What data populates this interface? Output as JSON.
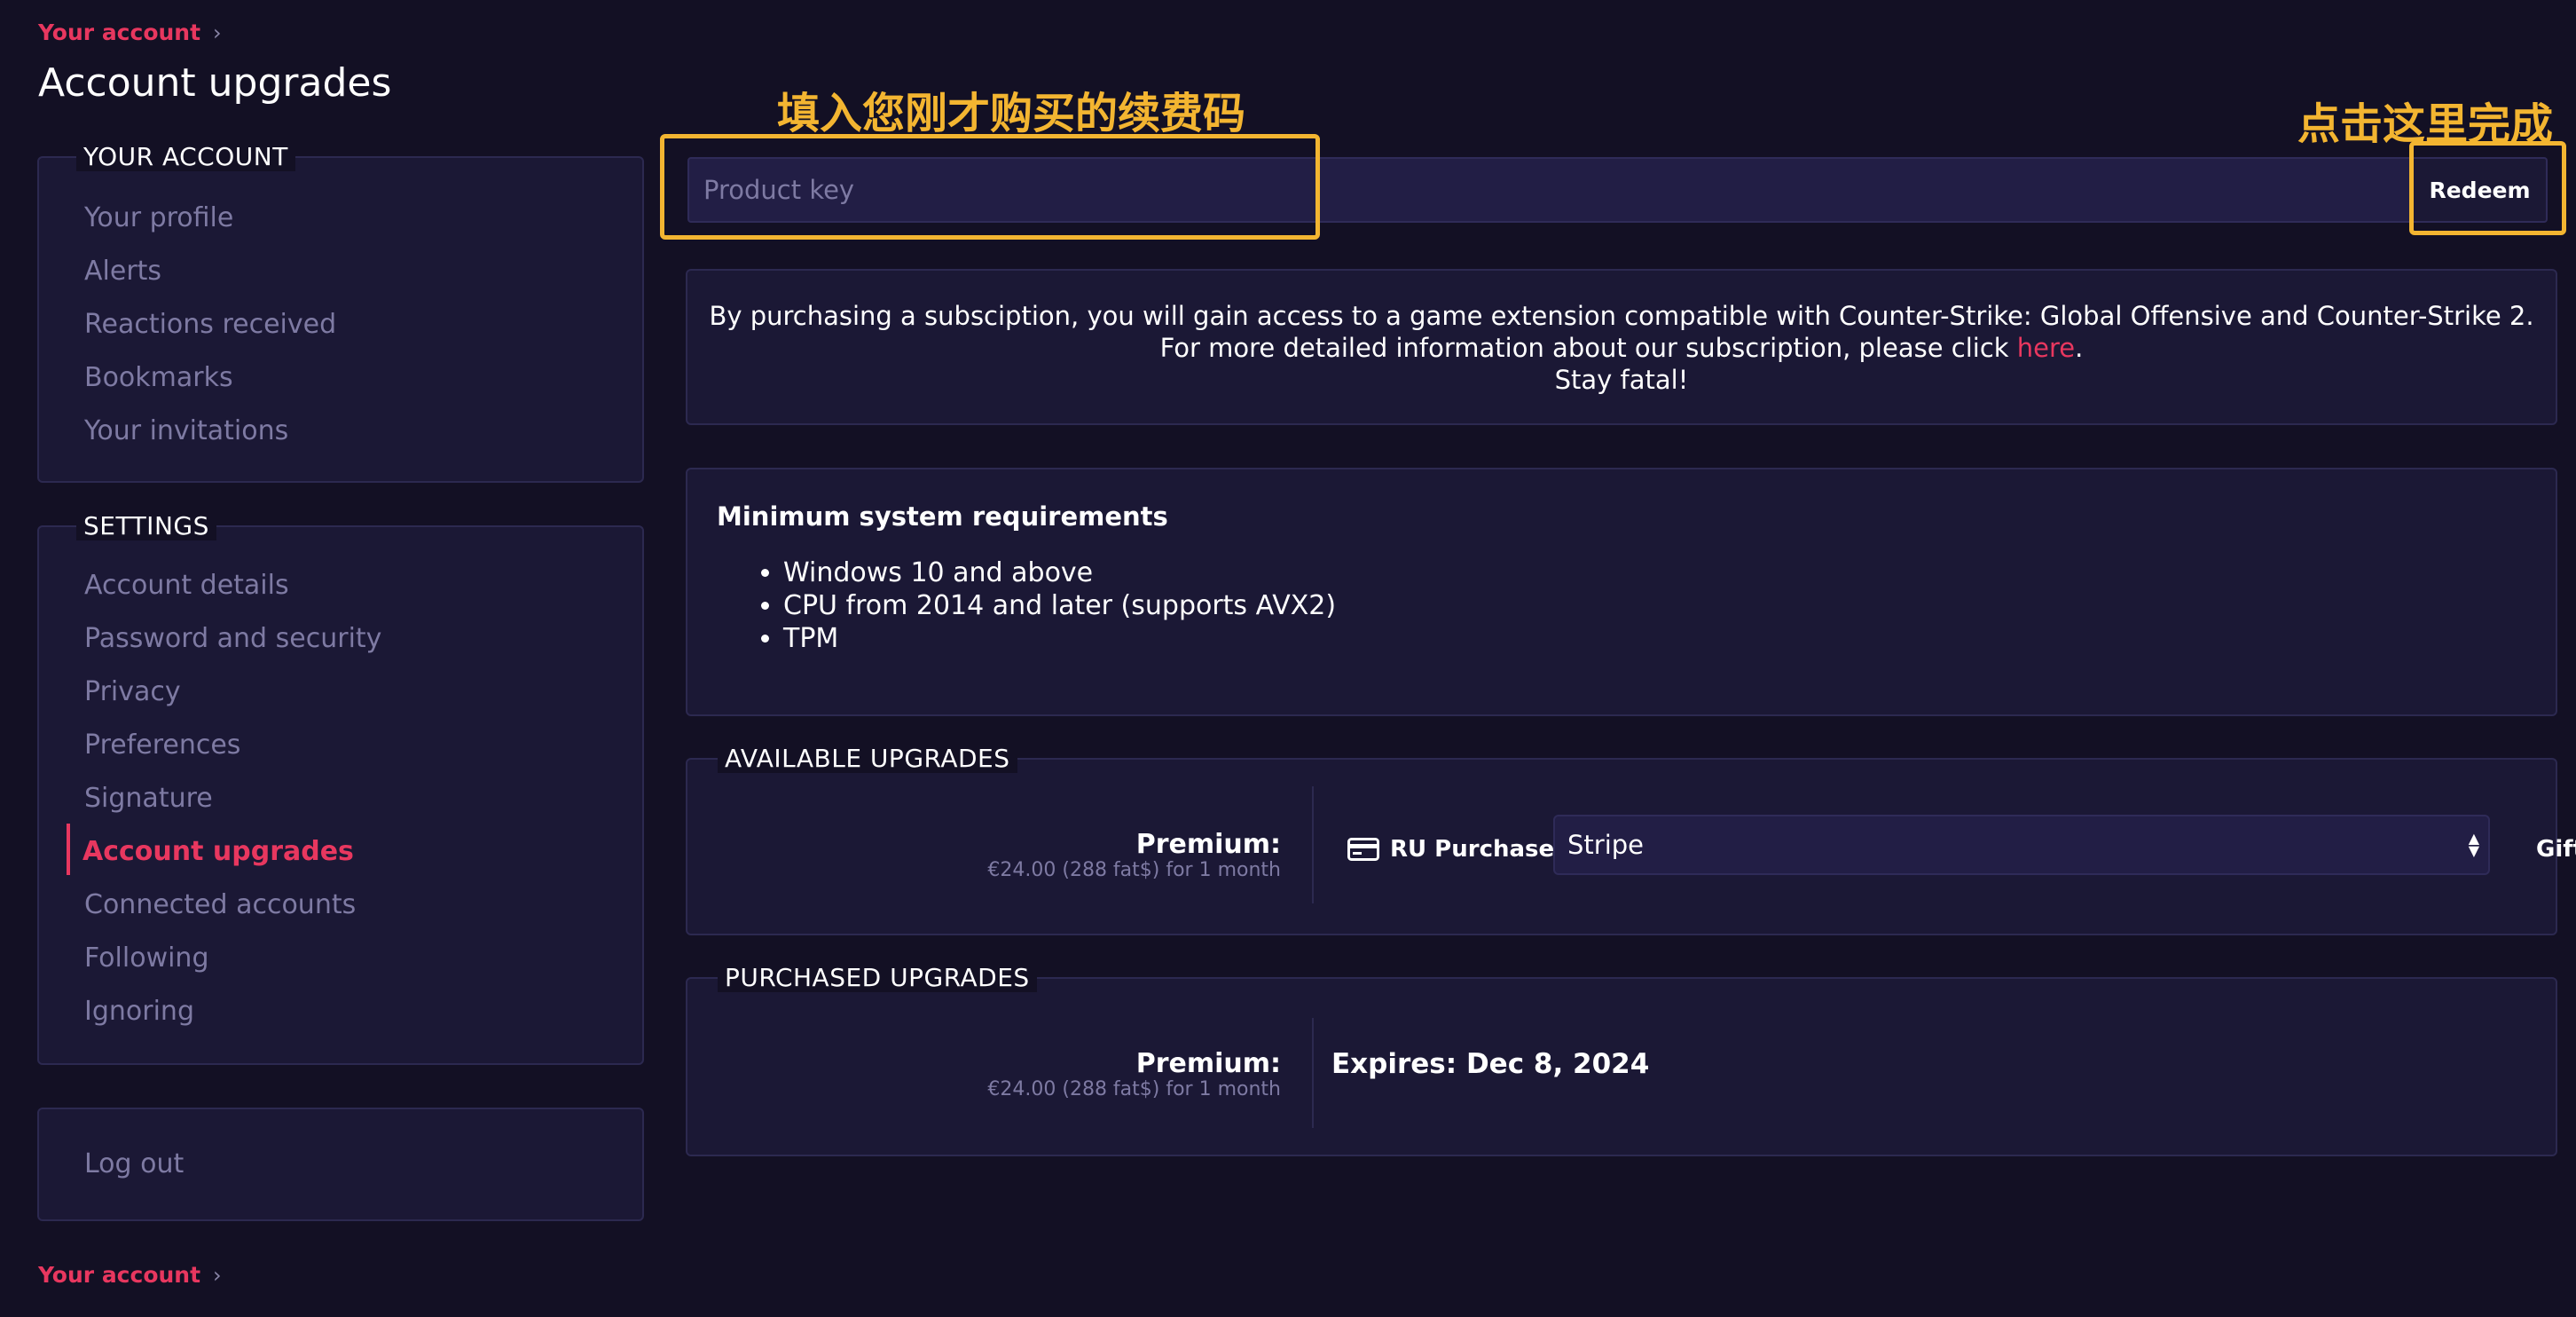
{
  "breadcrumb": {
    "label": "Your account"
  },
  "page_title": "Account upgrades",
  "sidebar": {
    "account_section": {
      "title": "YOUR ACCOUNT",
      "items": [
        "Your profile",
        "Alerts",
        "Reactions received",
        "Bookmarks",
        "Your invitations"
      ]
    },
    "settings_section": {
      "title": "SETTINGS",
      "items": [
        "Account details",
        "Password and security",
        "Privacy",
        "Preferences",
        "Signature",
        "Account upgrades",
        "Connected accounts",
        "Following",
        "Ignoring"
      ],
      "active_item": "Account upgrades"
    },
    "logout": "Log out"
  },
  "redeem": {
    "placeholder": "Product key",
    "button": "Redeem"
  },
  "info": {
    "line1": "By purchasing a subsciption, you will gain access to a game extension compatible with Counter-Strike: Global Offensive and Counter-Strike 2.",
    "line2_prefix": "For more detailed information about our subscription, please click ",
    "line2_link": "here",
    "line2_suffix": ".",
    "line3": "Stay fatal!"
  },
  "requirements": {
    "title": "Minimum system requirements",
    "items": [
      "Windows 10 and above",
      "CPU from 2014 and later (supports AVX2)",
      "TPM"
    ]
  },
  "available_upgrades": {
    "title": "AVAILABLE UPGRADES",
    "name": "Premium:",
    "price": "€24.00 (288 fat$) for 1 month",
    "purchase_label": "RU Purchase",
    "payment_method": "Stripe",
    "gift_label": "Gift"
  },
  "purchased_upgrades": {
    "title": "PURCHASED UPGRADES",
    "name": "Premium:",
    "price": "€24.00 (288 fat$) for 1 month",
    "expires": "Expires: Dec 8, 2024"
  },
  "annotations": {
    "input_hint": "填入您刚才购买的续费码",
    "button_hint": "点击这里完成"
  },
  "colors": {
    "background": "#131024",
    "panel": "#1b1835",
    "accent": "#e8375f",
    "muted_text": "#7e7aa3",
    "annotation": "#f3b531"
  }
}
